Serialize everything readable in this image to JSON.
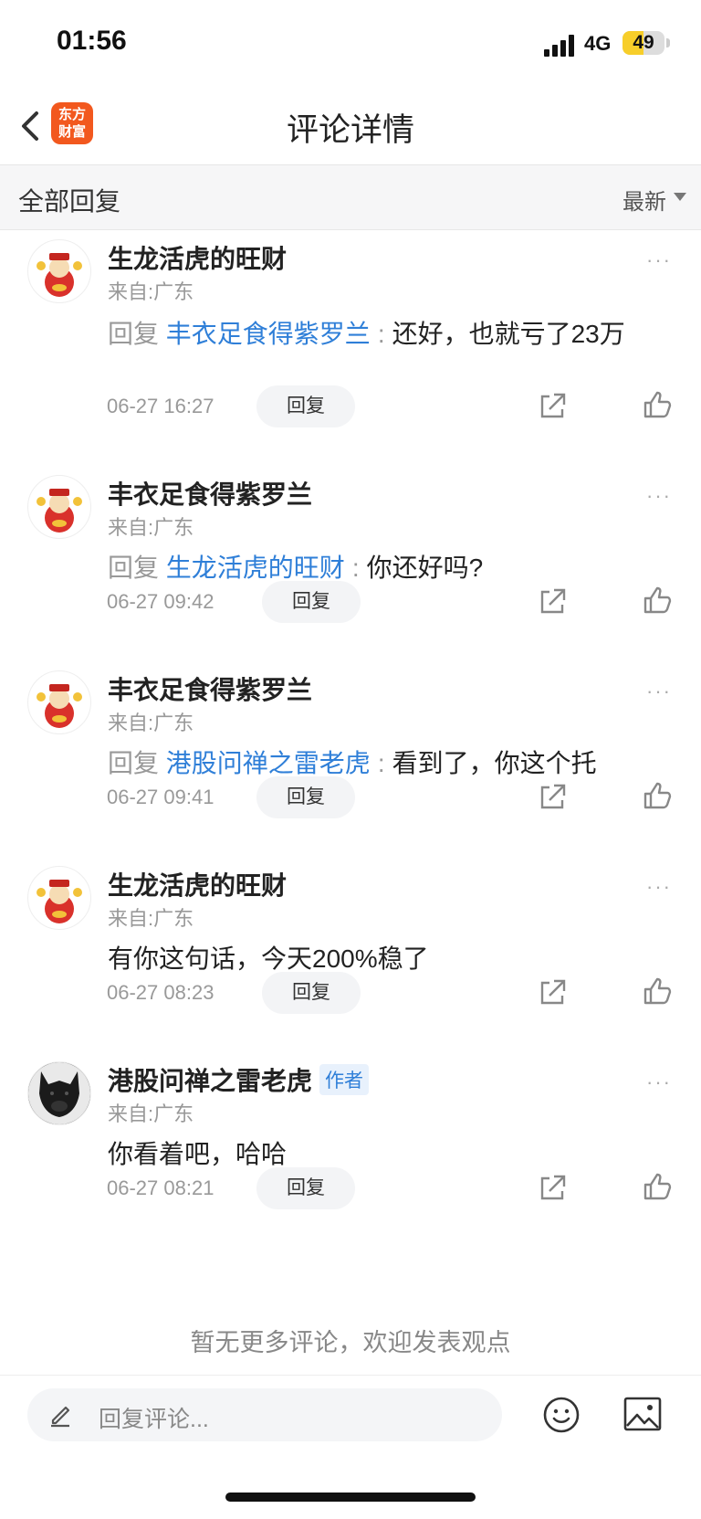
{
  "status": {
    "time": "01:56",
    "network": "4G",
    "battery": "49",
    "battery_level": 0.49
  },
  "nav": {
    "title": "评论详情",
    "logo_line1": "东方",
    "logo_line2": "财富"
  },
  "filter": {
    "left_label": "全部回复",
    "sort_label": "最新"
  },
  "reply_prefix": "回复",
  "more_dots": "···",
  "reply_button": "回复",
  "comments": [
    {
      "username": "生龙活虎的旺财",
      "location": "来自:广东",
      "reply_to": "丰衣足食得紫罗兰",
      "text": "还好，也就亏了23万",
      "date": "06-27 16:27"
    },
    {
      "username": "丰衣足食得紫罗兰",
      "location": "来自:广东",
      "reply_to": "生龙活虎的旺财",
      "text": "你还好吗?",
      "date": "06-27 09:42"
    },
    {
      "username": "丰衣足食得紫罗兰",
      "location": "来自:广东",
      "reply_to": "港股问禅之雷老虎",
      "text": "看到了，你这个托",
      "date": "06-27 09:41"
    },
    {
      "username": "生龙活虎的旺财",
      "location": "来自:广东",
      "text": "有你这句话，今天200%稳了",
      "date": "06-27 08:23"
    },
    {
      "username": "港股问禅之雷老虎",
      "author_badge": "作者",
      "location": "来自:广东",
      "text": "你看着吧，哈哈",
      "date": "06-27 08:21"
    }
  ],
  "no_more": "暂无更多评论，欢迎发表观点",
  "bottom": {
    "placeholder": "回复评论..."
  },
  "colors": {
    "accent": "#2f7fd8",
    "brand": "#f2581e",
    "battery": "#f7ce2a"
  }
}
